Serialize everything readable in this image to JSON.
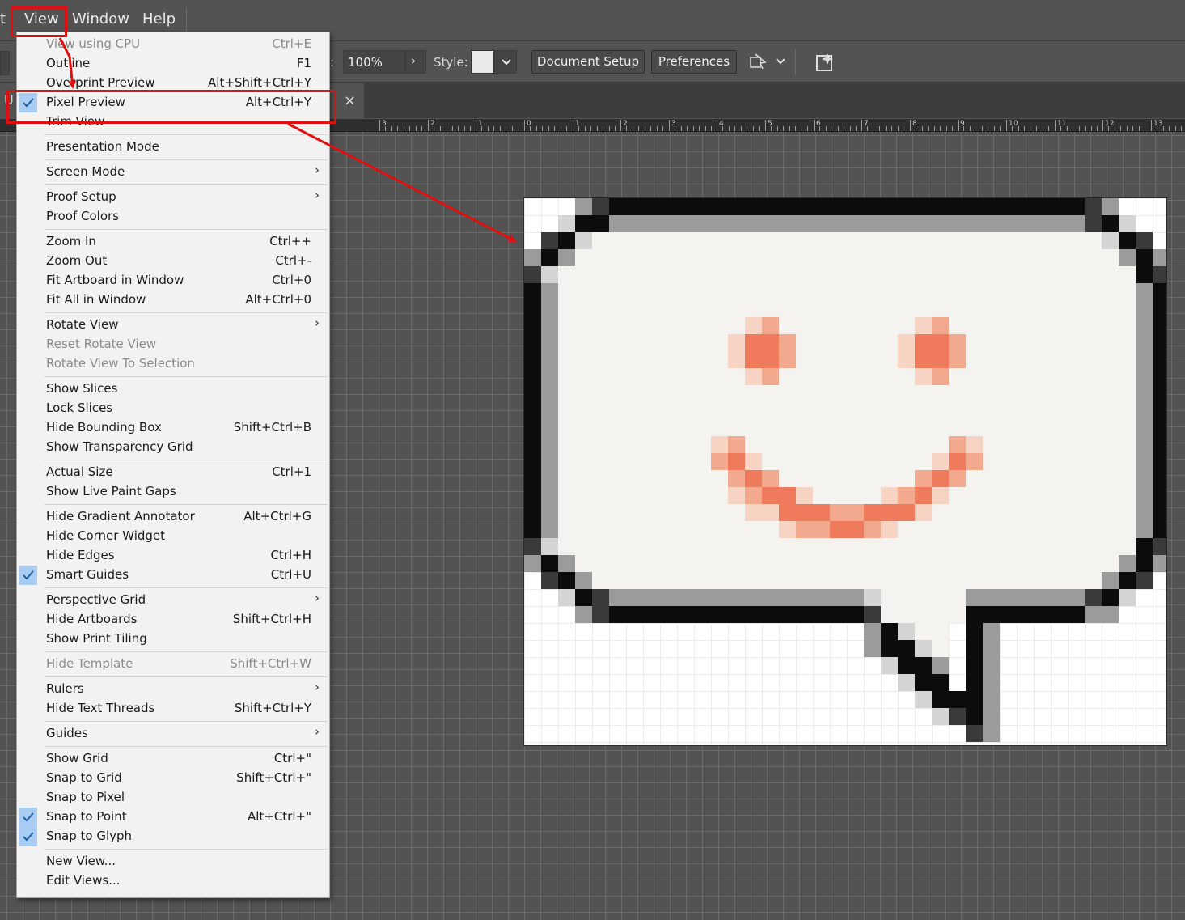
{
  "menubar": {
    "items": [
      {
        "label": "t"
      },
      {
        "label": "View"
      },
      {
        "label": "Window"
      },
      {
        "label": "Help"
      }
    ]
  },
  "controlbar": {
    "zoom_label_fragment": ":",
    "zoom_value": "100%",
    "style_label": "Style:",
    "document_setup_label": "Document Setup",
    "preferences_label": "Preferences"
  },
  "tab": {
    "title_fragment": "U",
    "close_glyph": "×"
  },
  "ruler": {
    "labels": [
      "3",
      "2",
      "1",
      "0",
      "1",
      "2",
      "3",
      "4",
      "5",
      "6",
      "7",
      "8",
      "9",
      "10",
      "11",
      "12",
      "13"
    ]
  },
  "view_menu": {
    "groups": [
      [
        {
          "label": "View using CPU",
          "shortcut": "Ctrl+E",
          "disabled": true
        },
        {
          "label": "Outline",
          "shortcut": "F1"
        },
        {
          "label": "Overprint Preview",
          "shortcut": "Alt+Shift+Ctrl+Y"
        },
        {
          "label": "Pixel Preview",
          "shortcut": "Alt+Ctrl+Y",
          "checked": true
        },
        {
          "label": "Trim View",
          "shortcut": ""
        }
      ],
      [
        {
          "label": "Presentation Mode",
          "shortcut": ""
        }
      ],
      [
        {
          "label": "Screen Mode",
          "shortcut": "",
          "submenu": true
        }
      ],
      [
        {
          "label": "Proof Setup",
          "shortcut": "",
          "submenu": true
        },
        {
          "label": "Proof Colors",
          "shortcut": ""
        }
      ],
      [
        {
          "label": "Zoom In",
          "shortcut": "Ctrl++"
        },
        {
          "label": "Zoom Out",
          "shortcut": "Ctrl+-"
        },
        {
          "label": "Fit Artboard in Window",
          "shortcut": "Ctrl+0"
        },
        {
          "label": "Fit All in Window",
          "shortcut": "Alt+Ctrl+0"
        }
      ],
      [
        {
          "label": "Rotate View",
          "shortcut": "",
          "submenu": true
        },
        {
          "label": "Reset Rotate View",
          "shortcut": "",
          "disabled": true
        },
        {
          "label": "Rotate View To Selection",
          "shortcut": "",
          "disabled": true
        }
      ],
      [
        {
          "label": "Show Slices",
          "shortcut": ""
        },
        {
          "label": "Lock Slices",
          "shortcut": ""
        },
        {
          "label": "Hide Bounding Box",
          "shortcut": "Shift+Ctrl+B"
        },
        {
          "label": "Show Transparency Grid",
          "shortcut": ""
        }
      ],
      [
        {
          "label": "Actual Size",
          "shortcut": "Ctrl+1"
        },
        {
          "label": "Show Live Paint Gaps",
          "shortcut": ""
        }
      ],
      [
        {
          "label": "Hide Gradient Annotator",
          "shortcut": "Alt+Ctrl+G"
        },
        {
          "label": "Hide Corner Widget",
          "shortcut": ""
        },
        {
          "label": "Hide Edges",
          "shortcut": "Ctrl+H"
        },
        {
          "label": "Smart Guides",
          "shortcut": "Ctrl+U",
          "checked": true
        }
      ],
      [
        {
          "label": "Perspective Grid",
          "shortcut": "",
          "submenu": true
        },
        {
          "label": "Hide Artboards",
          "shortcut": "Shift+Ctrl+H"
        },
        {
          "label": "Show Print Tiling",
          "shortcut": ""
        }
      ],
      [
        {
          "label": "Hide Template",
          "shortcut": "Shift+Ctrl+W",
          "disabled": true
        }
      ],
      [
        {
          "label": "Rulers",
          "shortcut": "",
          "submenu": true
        },
        {
          "label": "Hide Text Threads",
          "shortcut": "Shift+Ctrl+Y"
        }
      ],
      [
        {
          "label": "Guides",
          "shortcut": "",
          "submenu": true
        }
      ],
      [
        {
          "label": "Show Grid",
          "shortcut": "Ctrl+\""
        },
        {
          "label": "Snap to Grid",
          "shortcut": "Shift+Ctrl+\""
        },
        {
          "label": "Snap to Pixel",
          "shortcut": ""
        },
        {
          "label": "Snap to Point",
          "shortcut": "Alt+Ctrl+\"",
          "checked": true
        },
        {
          "label": "Snap to Glyph",
          "shortcut": "",
          "checked": true
        }
      ],
      [
        {
          "label": "New View...",
          "shortcut": ""
        },
        {
          "label": "Edit Views...",
          "shortcut": ""
        }
      ]
    ]
  },
  "colors": {
    "annotation_red": "#e01010",
    "check_highlight": "#a8ccf2",
    "bubble_fill": "#f5f3ef",
    "face_orange": "#ef7a5c"
  },
  "artwork": {
    "subject": "pixel speech bubble with smiley face",
    "cols": 38,
    "rows": 33
  }
}
